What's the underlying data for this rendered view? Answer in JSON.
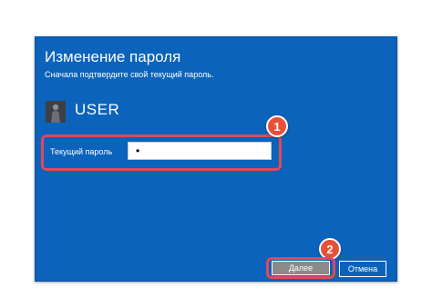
{
  "dialog": {
    "title": "Изменение пароля",
    "subtitle": "Сначала подтвердите свой текущий пароль.",
    "user": {
      "name": "USER"
    },
    "password_field": {
      "label": "Текущий пароль",
      "value": "•"
    },
    "buttons": {
      "next_label": "Далее",
      "cancel_label": "Отмена"
    }
  },
  "annotations": {
    "badge_1": "1",
    "badge_2": "2"
  },
  "colors": {
    "dialog_bg": "#0b63bb",
    "highlight": "#e1485b",
    "badge": "#e8503a",
    "next_button": "#8a8a8a"
  }
}
